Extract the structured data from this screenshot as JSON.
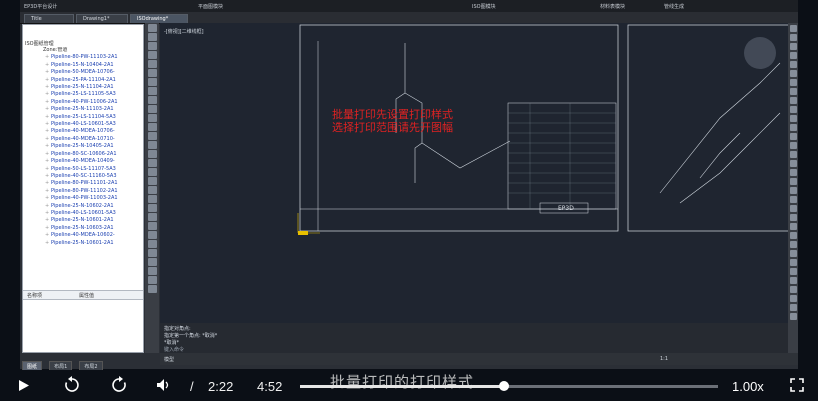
{
  "app": {
    "title": "EP3D平台设计",
    "menu": [
      "平面图模块",
      "ISO图模块",
      "材料表模块",
      "管线生成"
    ]
  },
  "tabs": [
    {
      "label": "Title",
      "active": false
    },
    {
      "label": "Drawing1*",
      "active": false
    },
    {
      "label": "ISOdrawing*",
      "active": true
    }
  ],
  "tree": {
    "header": "ISO图纸管理",
    "root": "Zone:管道",
    "items": [
      "Pipeline-80-PW-11103-2A1",
      "Pipeline-15-N-10404-2A1",
      "Pipeline-50-MDEA-10706-",
      "Pipeline-25-PA-11104-2A1",
      "Pipeline-25-N-11104-2A1",
      "Pipeline-25-LS-11105-5A3",
      "Pipeline-40-PW-11006-2A1",
      "Pipeline-25-N-11103-2A1",
      "Pipeline-25-LS-11104-5A3",
      "Pipeline-40-LS-10601-5A3",
      "Pipeline-40-MDEA-10706-",
      "Pipeline-40-MDEA-10710-",
      "Pipeline-25-N-10405-2A1",
      "Pipeline-80-SC-10606-2A1",
      "Pipeline-40-MDEA-10409-",
      "Pipeline-50-LS-11107-5A3",
      "Pipeline-40-SC-11160-5A3",
      "Pipeline-80-PW-11101-2A1",
      "Pipeline-80-PW-11102-2A1",
      "Pipeline-40-PW-11003-2A1",
      "Pipeline-25-N-10602-2A1",
      "Pipeline-40-LS-10601-5A3",
      "Pipeline-25-N-10601-2A1",
      "Pipeline-25-N-10603-2A1",
      "Pipeline-40-MDEA-10602-",
      "Pipeline-25-N-10601-2A1"
    ]
  },
  "properties": {
    "col1": "名称项",
    "col2": "属性值"
  },
  "bottom_tabs": [
    "图纸",
    "布局1",
    "布局2"
  ],
  "canvas": {
    "viewport_label": "-[俯视][二维线框]",
    "overlay_line1": "批量打印先设置打印样式",
    "overlay_line2": "选择打印范围请先开图幅",
    "titleblock_text": "EP3D"
  },
  "command": {
    "line1": "指定对角点:",
    "line2": "指定第一个角点: *取消*",
    "line3": "*取消*",
    "prompt": "键入命令"
  },
  "status": {
    "model": "模型",
    "scale": "1:1"
  },
  "player": {
    "current_time": "2:22",
    "separator": "/",
    "total_time": "4:52",
    "speed": "1.00x",
    "subtitle": "批量打印的打印样式",
    "progress": 0.487
  }
}
